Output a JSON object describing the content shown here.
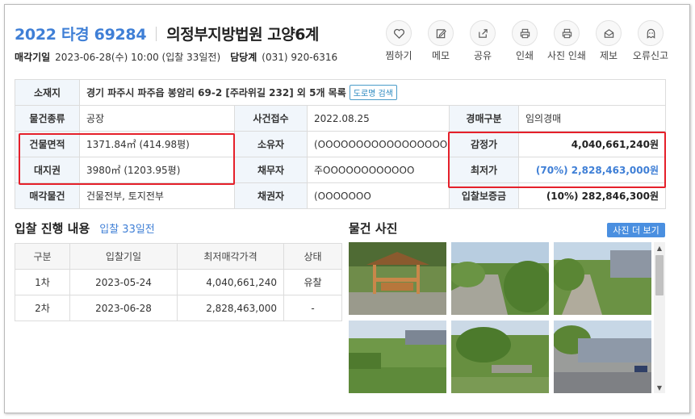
{
  "header": {
    "case_no": "2022 타경 69284",
    "court": "의정부지방법원 고양6계",
    "sale_date_label": "매각기일",
    "sale_date": "2023-06-28(수) 10:00 (입찰 33일전)",
    "dept_label": "담당계",
    "dept_phone": "(031) 920-6316"
  },
  "actions": [
    {
      "label": "찜하기",
      "icon": "heart-icon"
    },
    {
      "label": "메모",
      "icon": "memo-icon"
    },
    {
      "label": "공유",
      "icon": "share-icon"
    },
    {
      "label": "인쇄",
      "icon": "print-icon"
    },
    {
      "label": "사진 인쇄",
      "icon": "photo-print-icon"
    },
    {
      "label": "제보",
      "icon": "mail-icon"
    },
    {
      "label": "오류신고",
      "icon": "ghost-icon"
    }
  ],
  "info": {
    "location_label": "소재지",
    "location": "경기 파주시 파주읍 봉암리 69-2 [주라위길 232] 외 5개 목록",
    "road_btn": "도로명 검색",
    "type_label": "물건종류",
    "type": "공장",
    "received_label": "사건접수",
    "received": "2022.08.25",
    "auction_type_label": "경매구분",
    "auction_type": "임의경매",
    "bldg_area_label": "건물면적",
    "bldg_area": "1371.84㎡ (414.98평)",
    "owner_label": "소유자",
    "owner": "(OOOOOOOOOOOOOOOOO",
    "appraisal_label": "감정가",
    "appraisal": "4,040,661,240원",
    "land_label": "대지권",
    "land": "3980㎡ (1203.95평)",
    "debtor_label": "채무자",
    "debtor": "주OOOOOOOOOOOO",
    "min_label": "최저가",
    "min_price": "(70%) 2,828,463,000원",
    "sale_item_label": "매각물건",
    "sale_item": "건물전부, 토지전부",
    "creditor_label": "채권자",
    "creditor": "(OOOOOOO",
    "deposit_label": "입찰보증금",
    "deposit": "(10%) 282,846,300원"
  },
  "bids": {
    "title": "입찰 진행 내용",
    "note": "입찰 33일전",
    "headers": [
      "구분",
      "입찰기일",
      "최저매각가격",
      "상태"
    ],
    "rows": [
      [
        "1차",
        "2023-05-24",
        "4,040,661,240",
        "유찰"
      ],
      [
        "2차",
        "2023-06-28",
        "2,828,463,000",
        "-"
      ]
    ]
  },
  "photos": {
    "title": "물건 사진",
    "more_btn": "사진 더 보기"
  },
  "colors": {
    "accent": "#3f7fd6",
    "highlight": "#e5202a",
    "header_bg": "#f1f6fb"
  }
}
